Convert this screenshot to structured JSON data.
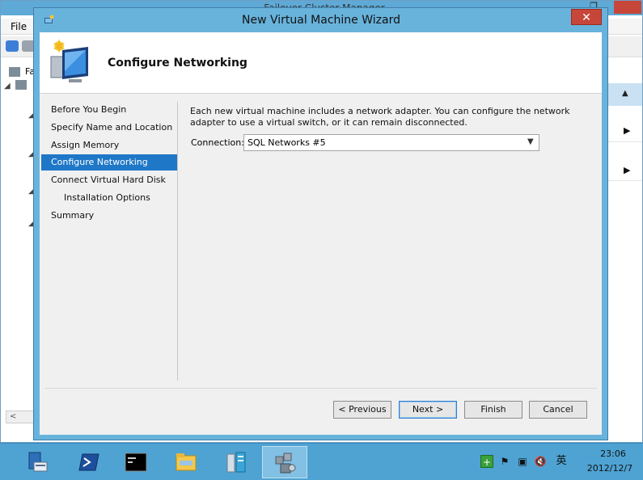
{
  "background_app": {
    "title": "Failover Cluster Manager",
    "menu_file": "File",
    "tree_label": "Fa",
    "restore_glyph": "❐",
    "actions_chevron": "▶",
    "actions_up": "▲"
  },
  "wizard": {
    "title": "New Virtual Machine Wizard",
    "close_glyph": "✕",
    "header_title": "Configure Networking",
    "steps": [
      {
        "label": "Before You Begin",
        "active": false,
        "sub": false
      },
      {
        "label": "Specify Name and Location",
        "active": false,
        "sub": false
      },
      {
        "label": "Assign Memory",
        "active": false,
        "sub": false
      },
      {
        "label": "Configure Networking",
        "active": true,
        "sub": false
      },
      {
        "label": "Connect Virtual Hard Disk",
        "active": false,
        "sub": false
      },
      {
        "label": "Installation Options",
        "active": false,
        "sub": true
      },
      {
        "label": "Summary",
        "active": false,
        "sub": false
      }
    ],
    "description": "Each new virtual machine includes a network adapter. You can configure the network adapter to use a virtual switch, or it can remain disconnected.",
    "connection_label": "Connection:",
    "connection_value": "SQL Networks #5",
    "buttons": {
      "previous": "< Previous",
      "next": "Next >",
      "finish": "Finish",
      "cancel": "Cancel"
    }
  },
  "taskbar": {
    "items": [
      "server-manager-icon",
      "powershell-icon",
      "command-prompt-icon",
      "file-explorer-icon",
      "hyperv-manager-icon",
      "failover-cluster-manager-icon"
    ],
    "tray": {
      "ime": "英"
    },
    "clock_time": "23:06",
    "clock_date": "2012/12/7"
  },
  "colors": {
    "accent": "#1e77c7",
    "titlebar": "#68b3dc",
    "close": "#c7463a",
    "taskbar": "#4ea3d3"
  }
}
